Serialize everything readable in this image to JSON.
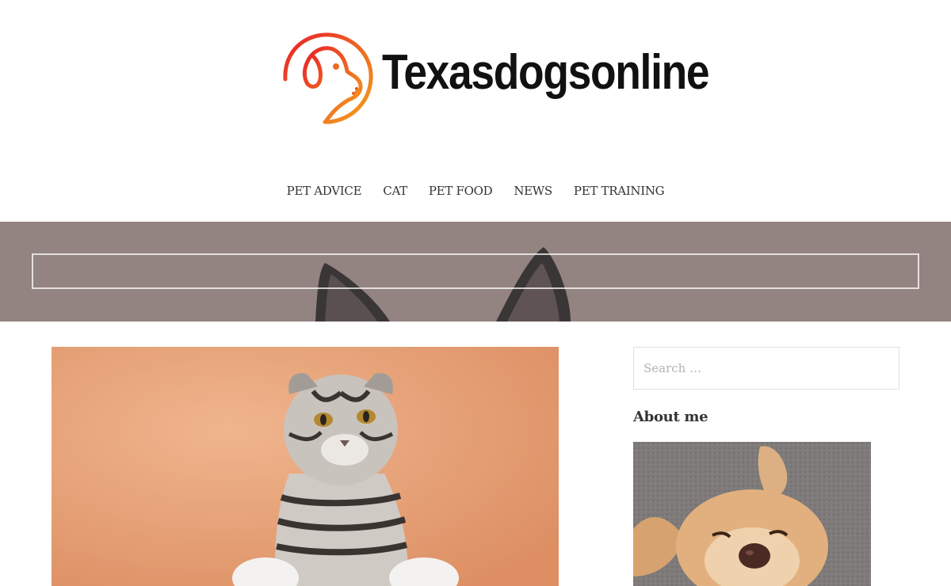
{
  "site": {
    "title": "Texasdogsonline",
    "logo_icon": "dog-head-outline-icon",
    "logo_gradient": [
      "#e8202a",
      "#f39a1c"
    ]
  },
  "nav": {
    "items": [
      {
        "label": "PET ADVICE"
      },
      {
        "label": "CAT"
      },
      {
        "label": "PET FOOD"
      },
      {
        "label": "NEWS"
      },
      {
        "label": "PET TRAINING"
      }
    ]
  },
  "hero": {
    "overlay_color": "#8c7d7c"
  },
  "sidebar": {
    "search_placeholder": "Search …",
    "about_title": "About me"
  }
}
